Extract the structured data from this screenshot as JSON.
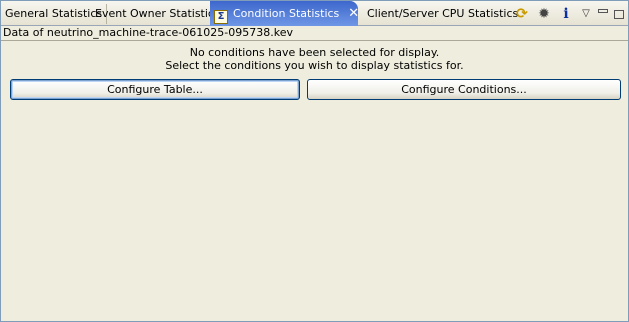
{
  "tabs": [
    {
      "label": "General Statistics"
    },
    {
      "label": "Event Owner Statistics"
    },
    {
      "label": "Condition Statistics"
    },
    {
      "label": "Client/Server CPU Statistics"
    }
  ],
  "active_tab_icon": "sigma-icon",
  "file_label": "Data of neutrino_machine-trace-061025-095738.kev",
  "message": {
    "line1": "No conditions have been selected for display.",
    "line2": "Select the conditions you wish to display statistics for."
  },
  "buttons": {
    "configure_table": "Configure Table...",
    "configure_conditions": "Configure Conditions..."
  },
  "toolbar_icons": [
    "sync-icon",
    "bug-icon",
    "info-icon",
    "view-menu-icon",
    "minimize-icon",
    "maximize-icon"
  ],
  "colors": {
    "active_tab": "#3d67cc",
    "background": "#efedde",
    "button_border": "#003c74"
  }
}
